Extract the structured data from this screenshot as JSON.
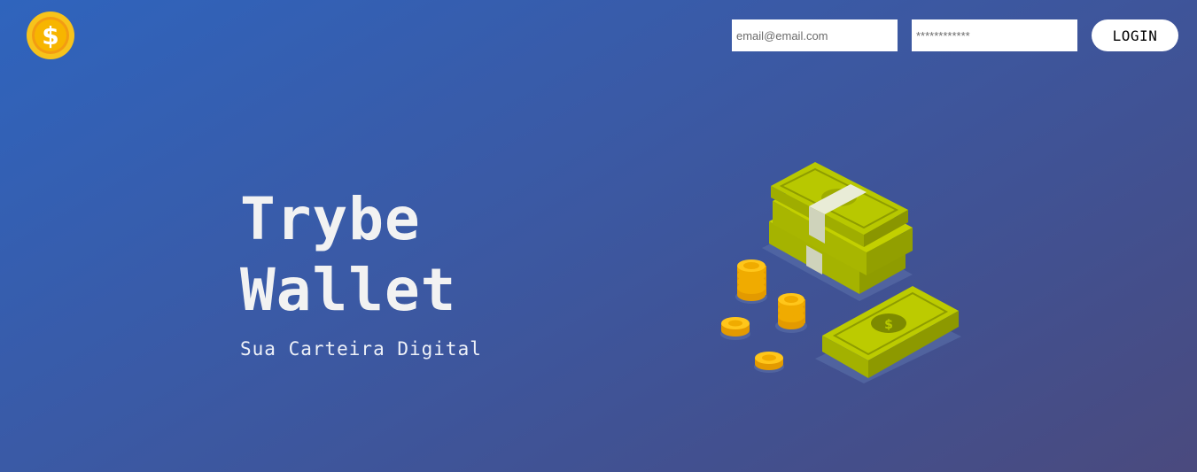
{
  "header": {
    "logo_icon": "dollar-coin-icon",
    "email_placeholder": "email@email.com",
    "password_placeholder": "************",
    "login_label": "LOGIN"
  },
  "hero": {
    "title_line1": "Trybe",
    "title_line2": "Wallet",
    "subtitle": "Sua Carteira Digital",
    "illustration_icon": "money-stacks-and-coins-illustration"
  },
  "colors": {
    "background_start": "#2f64bd",
    "background_end": "#4a4a7e",
    "money_green": "#b5c900",
    "coin_gold": "#f5b301"
  }
}
